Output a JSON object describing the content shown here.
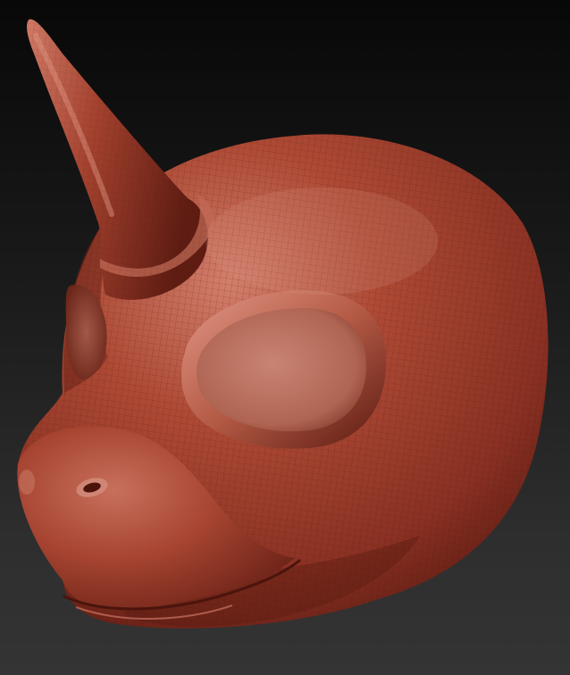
{
  "scene": {
    "subject": "sculpted-creature-head",
    "colors": {
      "background_top": "#080808",
      "background_bottom": "#343434",
      "clay_base": "#a8412e",
      "clay_highlight": "#d07a66",
      "clay_shadow": "#4a160f",
      "wire": "#5e1c12"
    }
  }
}
